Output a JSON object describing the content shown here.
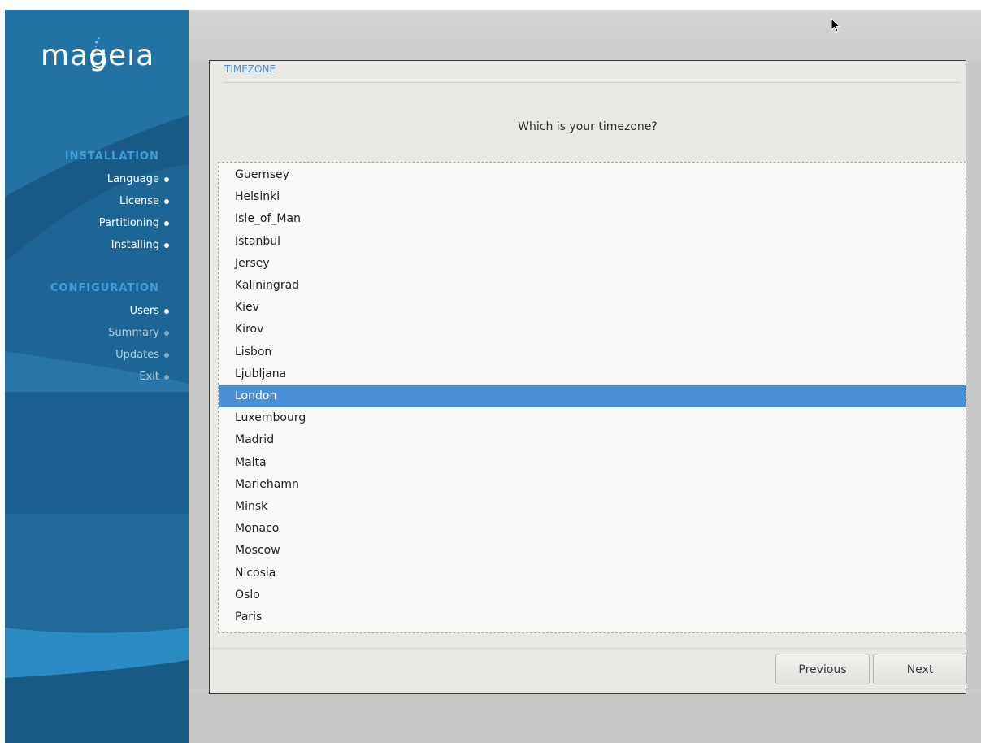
{
  "logo": {
    "text": "mageıa"
  },
  "sidebar": {
    "installation_title": "INSTALLATION",
    "installation_steps": [
      {
        "label": "Language",
        "done": true
      },
      {
        "label": "License",
        "done": true
      },
      {
        "label": "Partitioning",
        "done": true
      },
      {
        "label": "Installing",
        "done": true
      }
    ],
    "configuration_title": "CONFIGURATION",
    "configuration_steps": [
      {
        "label": "Users",
        "done": true
      },
      {
        "label": "Summary",
        "done": false
      },
      {
        "label": "Updates",
        "done": false
      },
      {
        "label": "Exit",
        "done": false
      }
    ]
  },
  "panel": {
    "title": "TIMEZONE",
    "question": "Which is your timezone?"
  },
  "timezones": {
    "selected": "London",
    "items": [
      "Guernsey",
      "Helsinki",
      "Isle_of_Man",
      "Istanbul",
      "Jersey",
      "Kaliningrad",
      "Kiev",
      "Kirov",
      "Lisbon",
      "Ljubljana",
      "London",
      "Luxembourg",
      "Madrid",
      "Malta",
      "Mariehamn",
      "Minsk",
      "Monaco",
      "Moscow",
      "Nicosia",
      "Oslo",
      "Paris"
    ]
  },
  "buttons": {
    "previous": "Previous",
    "next": "Next"
  },
  "colors": {
    "accent": "#4a90d9",
    "sidebar": "#1f6a99",
    "section_title": "#3f9fd8"
  },
  "icons": {
    "cursor": "mouse-pointer-icon"
  }
}
